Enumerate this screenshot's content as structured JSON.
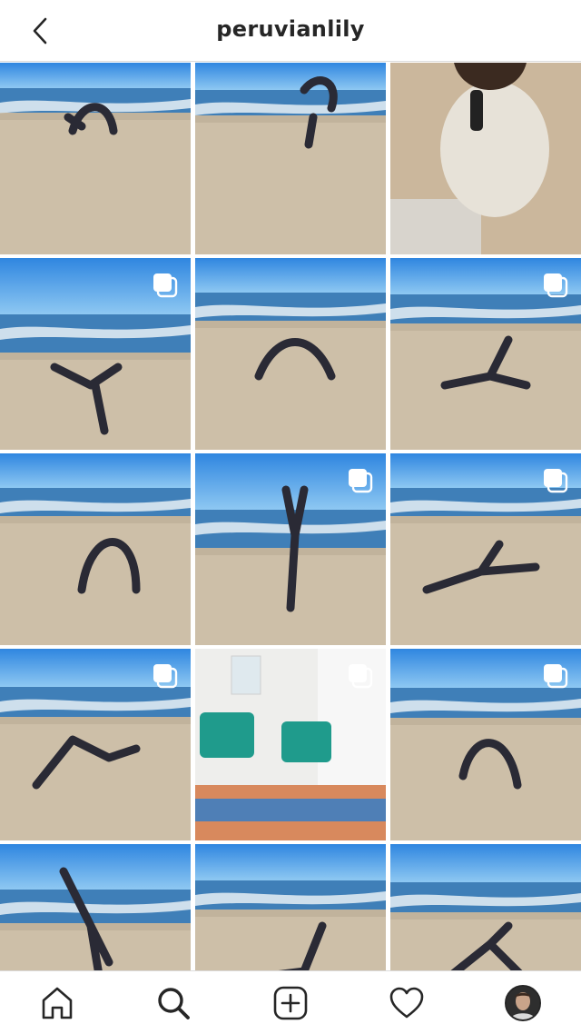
{
  "header": {
    "title": "peruvianlily",
    "back_icon": "chevron-left-icon"
  },
  "grid": {
    "posts": [
      {
        "scene": "beach",
        "multiple": false
      },
      {
        "scene": "beach",
        "multiple": false
      },
      {
        "scene": "portrait-sand",
        "multiple": false
      },
      {
        "scene": "beach",
        "multiple": true
      },
      {
        "scene": "beach",
        "multiple": false
      },
      {
        "scene": "beach",
        "multiple": true
      },
      {
        "scene": "beach",
        "multiple": false
      },
      {
        "scene": "beach",
        "multiple": true
      },
      {
        "scene": "beach",
        "multiple": true
      },
      {
        "scene": "beach",
        "multiple": true
      },
      {
        "scene": "indoor-room",
        "multiple": true
      },
      {
        "scene": "beach",
        "multiple": true
      },
      {
        "scene": "beach",
        "multiple": false
      },
      {
        "scene": "beach",
        "multiple": false
      },
      {
        "scene": "beach",
        "multiple": false
      }
    ]
  },
  "tabbar": {
    "items": [
      "home-icon",
      "search-icon",
      "add-post-icon",
      "heart-icon",
      "profile-avatar"
    ]
  },
  "colors": {
    "sky_top": "#2f86e0",
    "sky_bottom": "#8ec8f2",
    "ocean": "#3f7fb8",
    "surf": "#e8f0f5",
    "sand": "#cdbfa8",
    "text": "#262626",
    "divider": "#dbdbdb"
  }
}
